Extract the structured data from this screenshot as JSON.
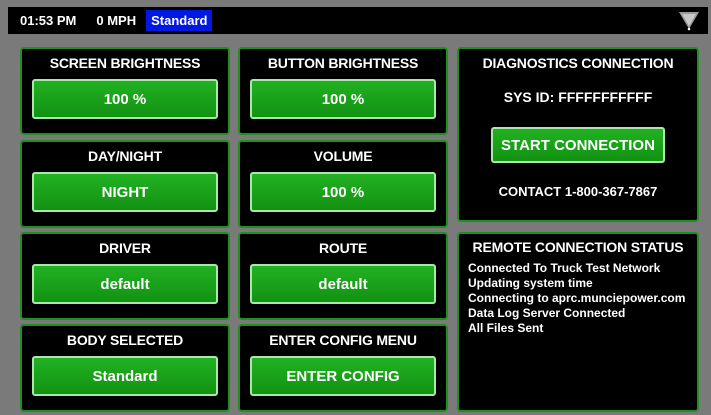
{
  "status_bar": {
    "time": "01:53 PM",
    "speed": "0 MPH",
    "mode": "Standard",
    "menu_icon": "triangle-down-icon"
  },
  "panels": {
    "screen_brightness": {
      "title": "SCREEN BRIGHTNESS",
      "value": "100 %"
    },
    "button_brightness": {
      "title": "BUTTON BRIGHTNESS",
      "value": "100 %"
    },
    "day_night": {
      "title": "DAY/NIGHT",
      "value": "NIGHT"
    },
    "volume": {
      "title": "VOLUME",
      "value": "100 %"
    },
    "driver": {
      "title": "DRIVER",
      "value": "default"
    },
    "route": {
      "title": "ROUTE",
      "value": "default"
    },
    "body_selected": {
      "title": "BODY SELECTED",
      "value": "Standard"
    },
    "config_menu": {
      "title": "ENTER CONFIG MENU",
      "value": "ENTER CONFIG"
    }
  },
  "diagnostics": {
    "title": "DIAGNOSTICS CONNECTION",
    "sys_id": "SYS ID: FFFFFFFFFFF",
    "button": "START CONNECTION",
    "contact": "CONTACT 1-800-367-7867"
  },
  "remote": {
    "title": "REMOTE CONNECTION STATUS",
    "lines": [
      "Connected To Truck Test Network",
      "Updating system time",
      "Connecting to aprc.munciepower.com",
      "Data Log Server Connected",
      "All Files Sent"
    ]
  },
  "colors": {
    "panel_border": "#1f8f1f",
    "button_green": "#1aa41a",
    "mode_badge": "#0018e0",
    "background": "#7a7a7a"
  }
}
